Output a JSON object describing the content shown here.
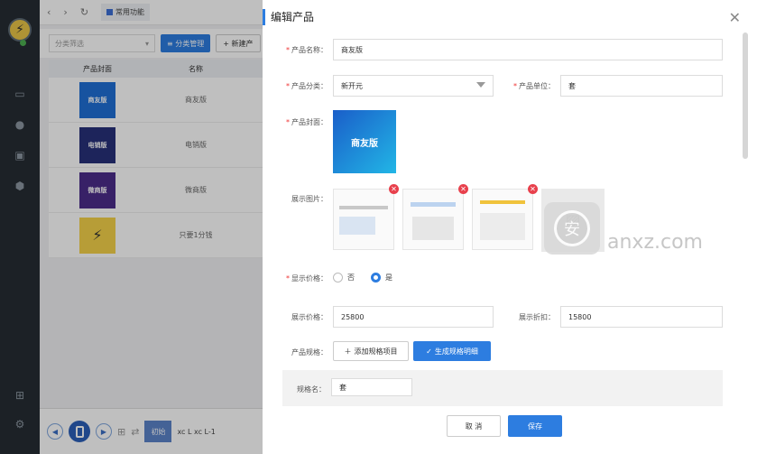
{
  "sidebar": {
    "avatar_icon": "pikachu-avatar-icon",
    "items": [
      "monitor-icon",
      "user-icon",
      "box-icon",
      "cube-icon",
      "grid-icon",
      "gear-icon"
    ]
  },
  "topbar": {
    "tab_label": "常用功能"
  },
  "filter": {
    "placeholder": "分类筛选",
    "category_button": "≡ 分类管理",
    "new_button": "+ 新建产"
  },
  "table": {
    "headers": [
      "产品封面",
      "名称"
    ],
    "rows": [
      {
        "thumb_text": "商友版",
        "name": "商友版",
        "color": "#1f6fd6"
      },
      {
        "thumb_text": "电销版",
        "name": "电销版",
        "color": "#27307a"
      },
      {
        "thumb_text": "微商版",
        "name": "微商版",
        "color": "#4b2d8a"
      },
      {
        "thumb_text": "",
        "name": "只要1分钱",
        "color": "#f4d24a"
      }
    ]
  },
  "bottombar": {
    "chip": "初始",
    "xcl1": "xc L",
    "xcl2": "xc L-1"
  },
  "modal": {
    "title": "编辑产品",
    "product_name_label": "产品名称：",
    "product_name": "商友版",
    "category_label": "产品分类：",
    "category": "新开元",
    "unit_label": "产品单位：",
    "unit": "套",
    "cover_label": "产品封面：",
    "cover_text": "商友版",
    "gallery_label": "展示图片：",
    "show_price_label": "显示价格：",
    "radio_no": "否",
    "radio_yes": "是",
    "display_price_label": "展示价格：",
    "display_price": "25800",
    "display_discount_label": "展示折扣：",
    "display_discount": "15800",
    "spec_label": "产品规格：",
    "add_spec_button": "添加规格项目",
    "generate_spec_button": "生成规格明细",
    "spec_name_label": "规格名：",
    "spec_name": "套",
    "cancel_button": "取 消",
    "save_button": "保存"
  },
  "watermark": {
    "text": "anxz.com",
    "glyph": "安"
  },
  "colors": {
    "accent": "#2d7de0",
    "sidebar": "#262d33",
    "danger": "#e8404c"
  }
}
